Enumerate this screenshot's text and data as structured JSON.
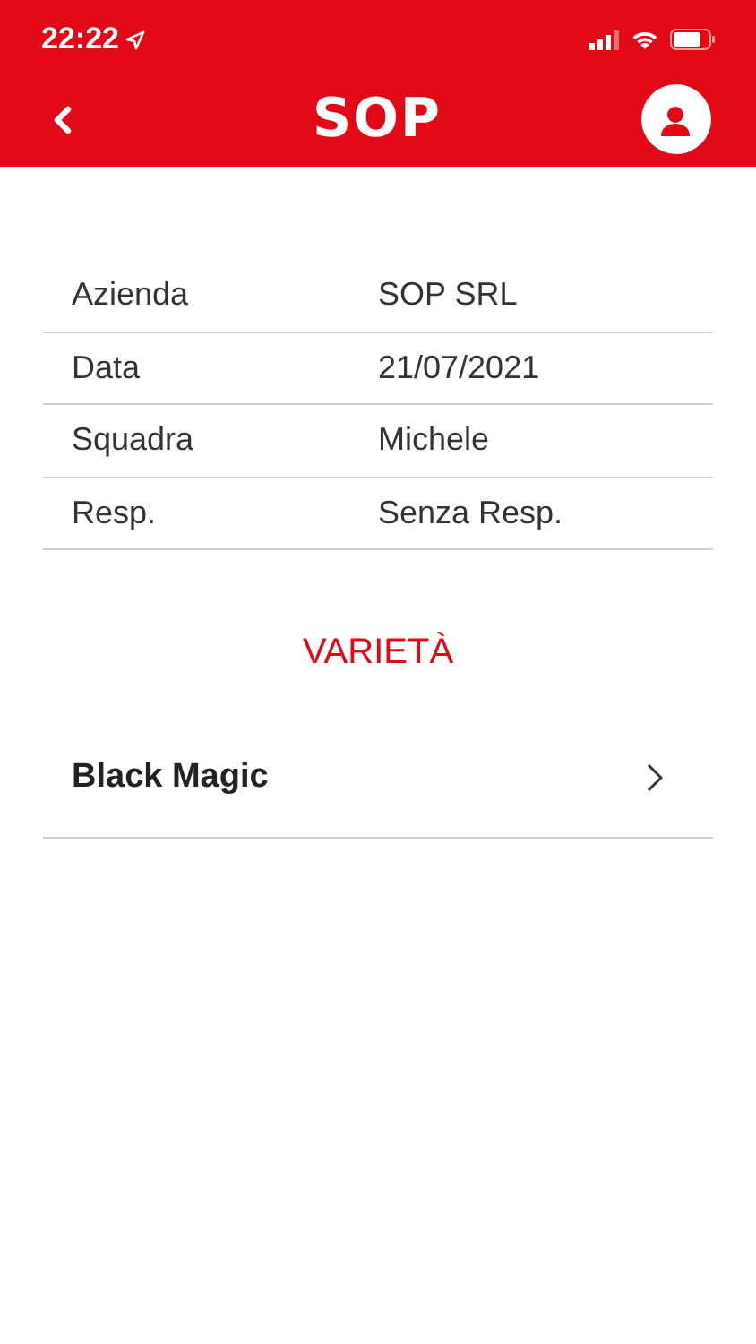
{
  "status_bar": {
    "time": "22:22"
  },
  "header": {
    "logo": "SOP"
  },
  "details": [
    {
      "label": "Azienda",
      "value": "SOP SRL"
    },
    {
      "label": "Data",
      "value": "21/07/2021"
    },
    {
      "label": "Squadra",
      "value": "Michele"
    },
    {
      "label": "Resp.",
      "value": "Senza Resp."
    }
  ],
  "section_title": "VARIETÀ",
  "varieties": [
    {
      "name": "Black Magic"
    }
  ]
}
